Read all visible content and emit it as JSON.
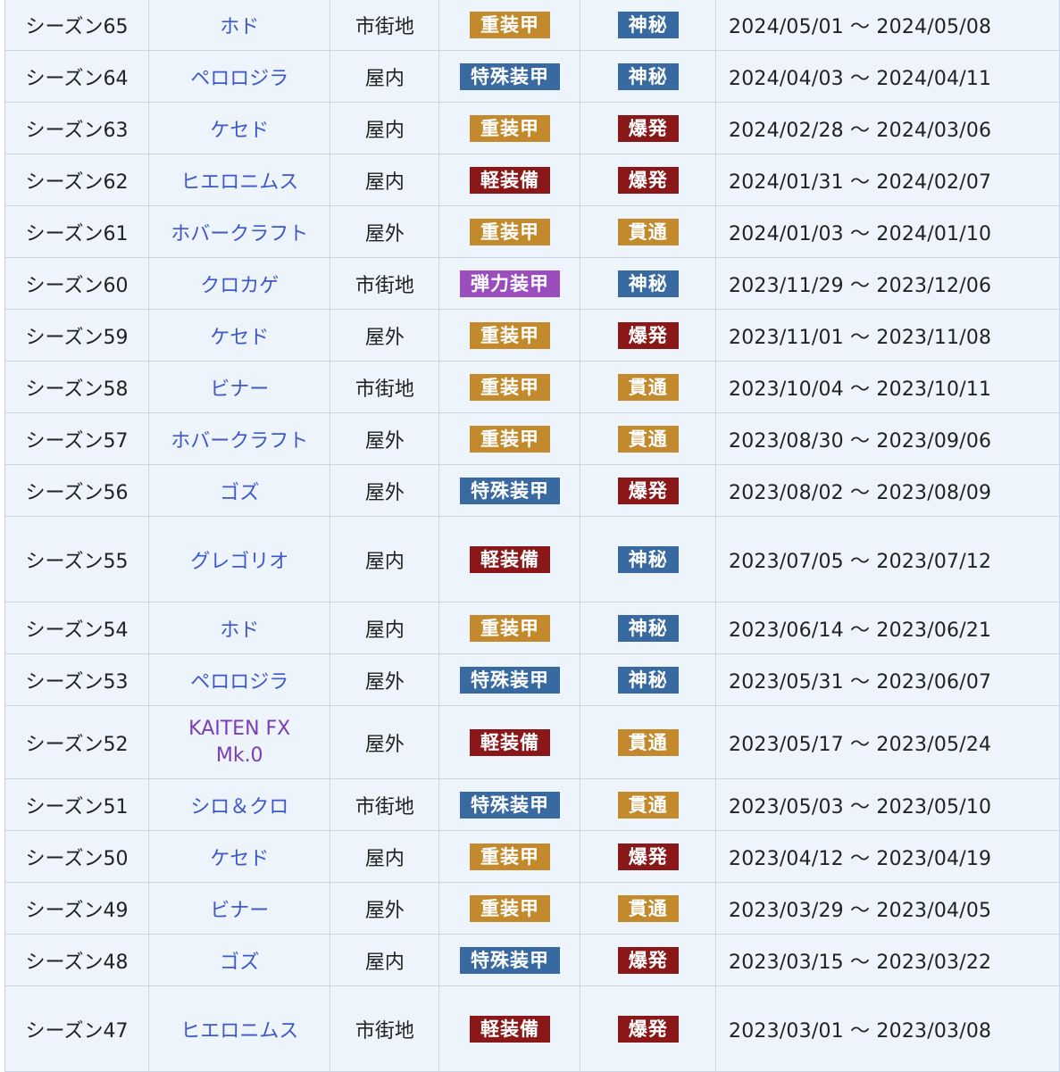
{
  "colors": {
    "重装甲": "#c28a2c",
    "特殊装甲": "#3869a1",
    "軽装備": "#8b1818",
    "弾力装甲": "#9b4dbd",
    "神秘": "#3869a1",
    "爆発": "#8b1818",
    "貫通": "#c28a2c"
  },
  "rows": [
    {
      "season": "シーズン65",
      "boss": "ホド",
      "terrain": "市街地",
      "armor": "重装甲",
      "attack": "神秘",
      "period": "2024/05/01 ～ 2024/05/08"
    },
    {
      "season": "シーズン64",
      "boss": "ペロロジラ",
      "terrain": "屋内",
      "armor": "特殊装甲",
      "attack": "神秘",
      "period": "2024/04/03 ～ 2024/04/11"
    },
    {
      "season": "シーズン63",
      "boss": "ケセド",
      "terrain": "屋内",
      "armor": "重装甲",
      "attack": "爆発",
      "period": "2024/02/28 ～ 2024/03/06"
    },
    {
      "season": "シーズン62",
      "boss": "ヒエロニムス",
      "terrain": "屋内",
      "armor": "軽装備",
      "attack": "爆発",
      "period": "2024/01/31 ～ 2024/02/07"
    },
    {
      "season": "シーズン61",
      "boss": "ホバークラフト",
      "terrain": "屋外",
      "armor": "重装甲",
      "attack": "貫通",
      "period": "2024/01/03 ～ 2024/01/10"
    },
    {
      "season": "シーズン60",
      "boss": "クロカゲ",
      "terrain": "市街地",
      "armor": "弾力装甲",
      "attack": "神秘",
      "period": "2023/11/29 ～ 2023/12/06"
    },
    {
      "season": "シーズン59",
      "boss": "ケセド",
      "terrain": "屋外",
      "armor": "重装甲",
      "attack": "爆発",
      "period": "2023/11/01 ～ 2023/11/08"
    },
    {
      "season": "シーズン58",
      "boss": "ビナー",
      "terrain": "市街地",
      "armor": "重装甲",
      "attack": "貫通",
      "period": "2023/10/04 ～ 2023/10/11"
    },
    {
      "season": "シーズン57",
      "boss": "ホバークラフト",
      "terrain": "屋外",
      "armor": "重装甲",
      "attack": "貫通",
      "period": "2023/08/30 ～ 2023/09/06"
    },
    {
      "season": "シーズン56",
      "boss": "ゴズ",
      "terrain": "屋外",
      "armor": "特殊装甲",
      "attack": "爆発",
      "period": "2023/08/02 ～ 2023/08/09"
    },
    {
      "season": "シーズン55",
      "boss": "グレゴリオ",
      "terrain": "屋内",
      "armor": "軽装備",
      "attack": "神秘",
      "period": "2023/07/05 ～ 2023/07/12",
      "tall": true
    },
    {
      "season": "シーズン54",
      "boss": "ホド",
      "terrain": "屋内",
      "armor": "重装甲",
      "attack": "神秘",
      "period": "2023/06/14 ～ 2023/06/21"
    },
    {
      "season": "シーズン53",
      "boss": "ペロロジラ",
      "terrain": "屋外",
      "armor": "特殊装甲",
      "attack": "神秘",
      "period": "2023/05/31 ～ 2023/06/07"
    },
    {
      "season": "シーズン52",
      "boss": "KAITEN FX Mk.0",
      "terrain": "屋外",
      "armor": "軽装備",
      "attack": "貫通",
      "period": "2023/05/17 ～ 2023/05/24",
      "tall2": true,
      "purple": true
    },
    {
      "season": "シーズン51",
      "boss": "シロ＆クロ",
      "terrain": "市街地",
      "armor": "特殊装甲",
      "attack": "貫通",
      "period": "2023/05/03 ～ 2023/05/10"
    },
    {
      "season": "シーズン50",
      "boss": "ケセド",
      "terrain": "屋内",
      "armor": "重装甲",
      "attack": "爆発",
      "period": "2023/04/12 ～ 2023/04/19"
    },
    {
      "season": "シーズン49",
      "boss": "ビナー",
      "terrain": "屋外",
      "armor": "重装甲",
      "attack": "貫通",
      "period": "2023/03/29 ～ 2023/04/05"
    },
    {
      "season": "シーズン48",
      "boss": "ゴズ",
      "terrain": "屋内",
      "armor": "特殊装甲",
      "attack": "爆発",
      "period": "2023/03/15 ～ 2023/03/22"
    },
    {
      "season": "シーズン47",
      "boss": "ヒエロニムス",
      "terrain": "市街地",
      "armor": "軽装備",
      "attack": "爆発",
      "period": "2023/03/01 ～ 2023/03/08",
      "tall": true
    }
  ]
}
